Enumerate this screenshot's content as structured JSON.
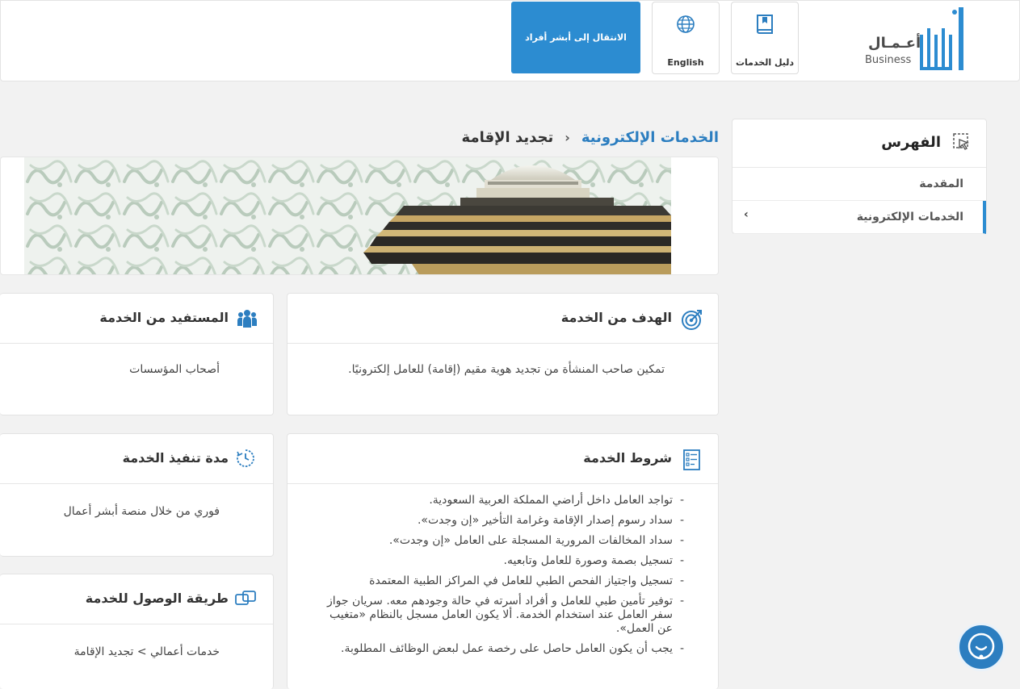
{
  "header": {
    "logo_ar": "أعـمـال",
    "logo_en": "Business",
    "guide_label": "دليل الخدمات",
    "lang_label": "English",
    "absher_button": "الانتقال إلى أبشر أفراد"
  },
  "sidebar": {
    "title": "الفهرس",
    "items": [
      {
        "label": "المقدمة",
        "active": false
      },
      {
        "label": "الخدمات الإلكترونية",
        "active": true
      }
    ]
  },
  "breadcrumb": {
    "parent": "الخدمات الإلكترونية",
    "separator": "›",
    "current": "تجديد الإقامة"
  },
  "cards": {
    "goal": {
      "title": "الهدف من الخدمة",
      "text": "تمكين صاحب المنشأة من تجديد هوية مقيم (إقامة) للعامل إلكترونيًا."
    },
    "beneficiary": {
      "title": "المستفيد من الخدمة",
      "text": "أصحاب المؤسسات"
    },
    "conditions": {
      "title": "شروط الخدمة",
      "items": [
        "تواجد العامل داخل أراضي المملكة العربية السعودية.",
        "سداد رسوم إصدار الإقامة وغرامة التأخير «إن وجدت».",
        "سداد المخالفات المرورية المسجلة على العامل «إن وجدت».",
        "تسجيل بصمة وصورة للعامل وتابعيه.",
        "تسجيل واجتياز الفحص الطبي للعامل في المراكز الطبية المعتمدة",
        "توفير تأمين طبي للعامل و أفراد أسرته في حالة وجودهم معه. سريان جواز سفر العامل عند استخدام الخدمة. ألا يكون العامل مسجل بالنظام «متغيب عن العمل».",
        "يجب أن يكون العامل حاصل على رخصة عمل لبعض الوظائف المطلوبة."
      ]
    },
    "duration": {
      "title": "مدة تنفيذ الخدمة",
      "text": "فوري من خلال منصة أبشر أعمال"
    },
    "access": {
      "title": "طريقة الوصول للخدمة",
      "text": "خدمات أعمالي > تجديد الإقامة"
    }
  },
  "colors": {
    "accent": "#2c8cd1",
    "link": "#2c7ec0",
    "icon": "#2c7ec0",
    "background": "#f2f2f2"
  },
  "icons": {
    "guide": "book-icon",
    "lang": "globe-icon",
    "index": "cursor-select-icon",
    "goal": "target-icon",
    "beneficiary": "users-icon",
    "conditions": "checklist-icon",
    "duration": "clock-icon",
    "access": "link-icon",
    "chat": "chat-support-icon"
  }
}
